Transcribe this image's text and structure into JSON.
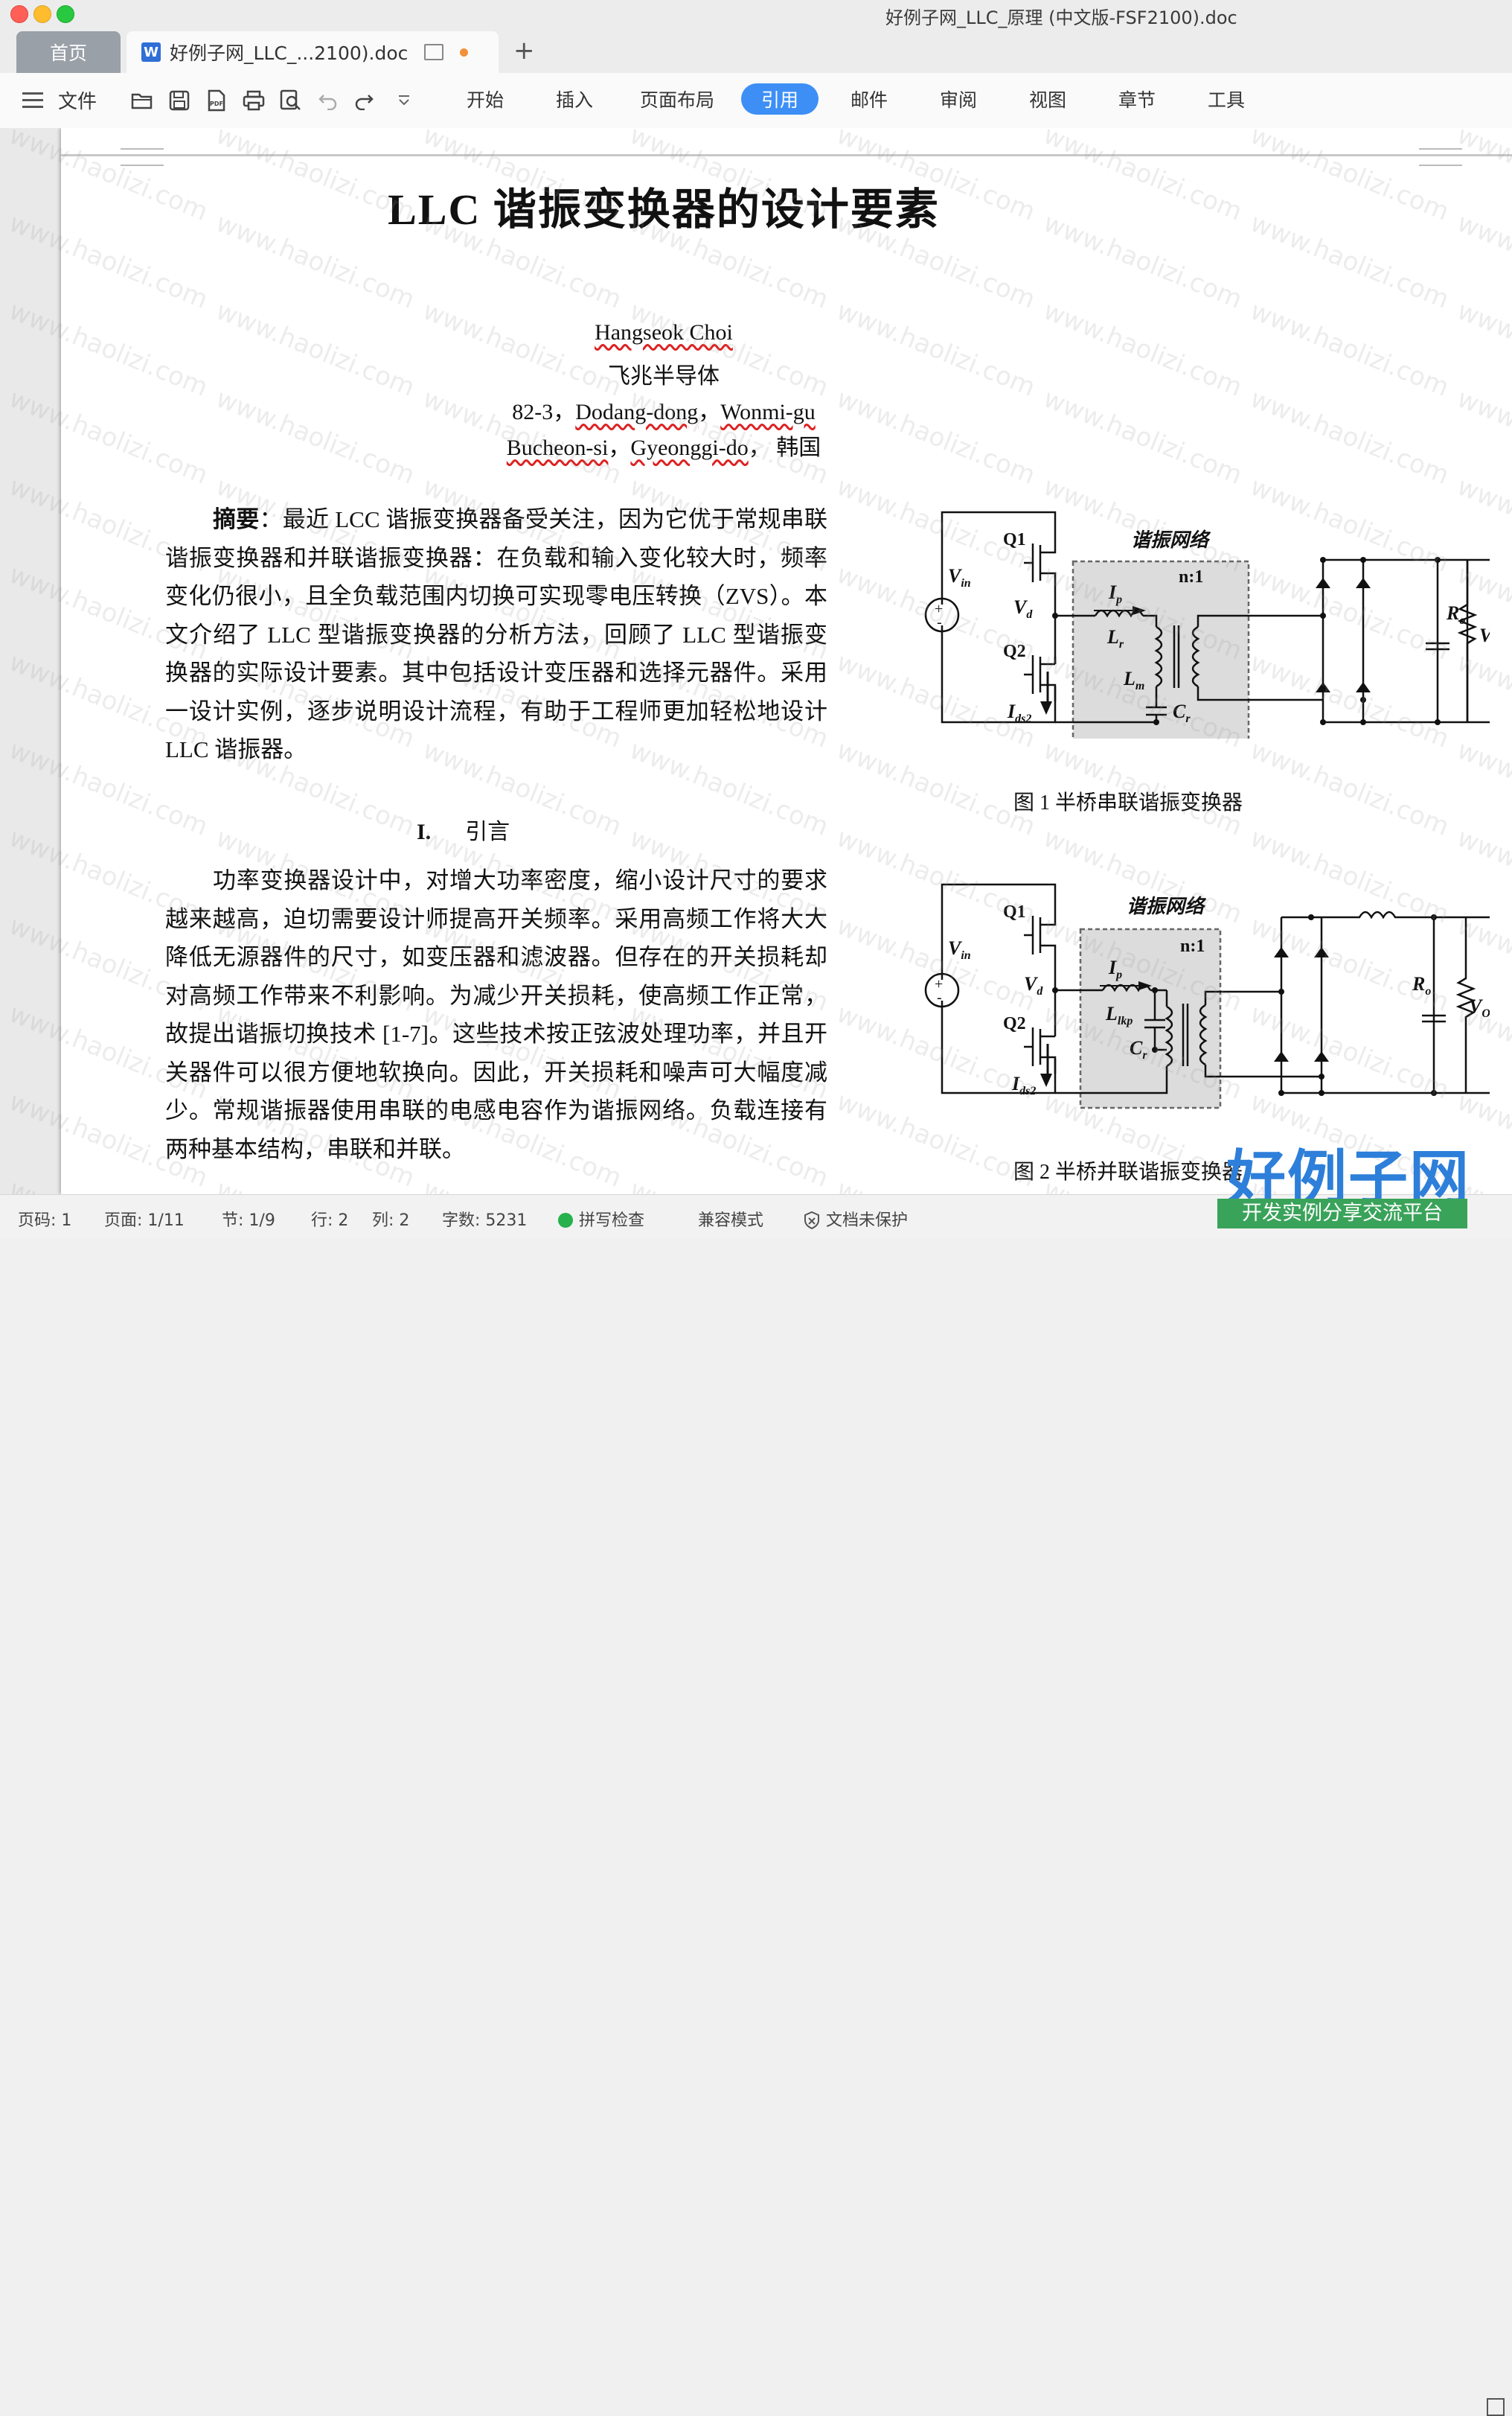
{
  "window": {
    "title": "好例子网_LLC_原理 (中文版-FSF2100).doc"
  },
  "tabs": {
    "home": "首页",
    "doc": "好例子网_LLC_...2100).doc",
    "add": "+"
  },
  "toolbar": {
    "file": "文件",
    "icons": [
      "open-folder-icon",
      "save-icon",
      "pdf-icon",
      "print-icon",
      "print-preview-icon",
      "undo-icon",
      "redo-icon",
      "more-dropdown-icon"
    ],
    "ribbon": [
      "开始",
      "插入",
      "页面布局",
      "引用",
      "邮件",
      "审阅",
      "视图",
      "章节",
      "工具"
    ],
    "active_ribbon": "引用",
    "accent": "#3d8ff5"
  },
  "document": {
    "title": "LLC  谐振变换器的设计要素",
    "author": "Hangseok Choi",
    "affiliation": "飞兆半导体",
    "address1_a": "82-3，",
    "address1_b": "Dodang-dong",
    "address1_c": "，",
    "address1_d": "Wonmi-gu",
    "address2_a": "Bucheon-si",
    "address2_b": "，",
    "address2_c": "Gyeonggi-do",
    "address2_d": "，  韩国",
    "abstract_label": "摘要",
    "abstract_text": "：最近 LCC 谐振变换器备受关注，因为它优于常规串联谐振变换器和并联谐振变换器：在负载和输入变化较大时，频率变化仍很小，且全负载范围内切换可实现零电压转换（ZVS）。本文介绍了 LLC 型谐振变换器的分析方法，回顾了 LLC 型谐振变换器的实际设计要素。其中包括设计变压器和选择元器件。采用一设计实例，逐步说明设计流程，有助于工程师更加轻松地设计 LLC 谐振器。",
    "section_num": "I.",
    "section_title": "引言",
    "intro_text": "功率变换器设计中，对增大功率密度，缩小设计尺寸的要求越来越高，迫切需要设计师提高开关频率。采用高频工作将大大降低无源器件的尺寸，如变压器和滤波器。但存在的开关损耗却对高频工作带来不利影响。为减少开关损耗，使高频工作正常，故提出谐振切换技术 [1-7]。这些技术按正弦波处理功率，并且开关器件可以很方便地软换向。因此，开关损耗和噪声可大幅度减少。常规谐振器使用串联的电感电容作为谐振网络。负载连接有两种基本结构，串联和并联。",
    "fig1": {
      "caption": "图 1    半桥串联谐振变换器",
      "network_label": "谐振网络",
      "labels": {
        "q1": "Q1",
        "q2": "Q2",
        "vin": "V",
        "vin_sub": "in",
        "vd": "V",
        "vd_sub": "d",
        "ip": "I",
        "ip_sub": "p",
        "lr": "L",
        "lr_sub": "r",
        "lm": "L",
        "lm_sub": "m",
        "cr": "C",
        "cr_sub": "r",
        "ratio": "n:1",
        "ids": "I",
        "ids_sub": "ds2",
        "ro": "R",
        "ro_sub": "o",
        "vo": "V",
        "vo_sub": "O",
        "plus": "+",
        "minus": "-"
      }
    },
    "fig2": {
      "caption": "图 2    半桥并联谐振变换器",
      "network_label": "谐振网络",
      "labels": {
        "q1": "Q1",
        "q2": "Q2",
        "vin": "V",
        "vin_sub": "in",
        "vd": "V",
        "vd_sub": "d",
        "ip": "I",
        "ip_sub": "p",
        "llkp": "L",
        "llkp_sub": "lkp",
        "cr": "C",
        "cr_sub": "r",
        "ratio": "n:1",
        "ids": "I",
        "ids_sub": "ds2",
        "ro": "R",
        "ro_sub": "o",
        "vo": "V",
        "vo_sub": "O",
        "plus": "+",
        "minus": "-"
      }
    },
    "watermark_text": "www.haolizi.com"
  },
  "statusbar": {
    "page_code": "页码: 1",
    "page": "页面: 1/11",
    "section": "节: 1/9",
    "row": "行: 2",
    "col": "列: 2",
    "words": "字数: 5231",
    "spell": "拼写检查",
    "compat": "兼容模式",
    "protect": "文档未保护"
  },
  "brand": {
    "name": "好例子网",
    "slogan": "开发实例分享交流平台"
  }
}
